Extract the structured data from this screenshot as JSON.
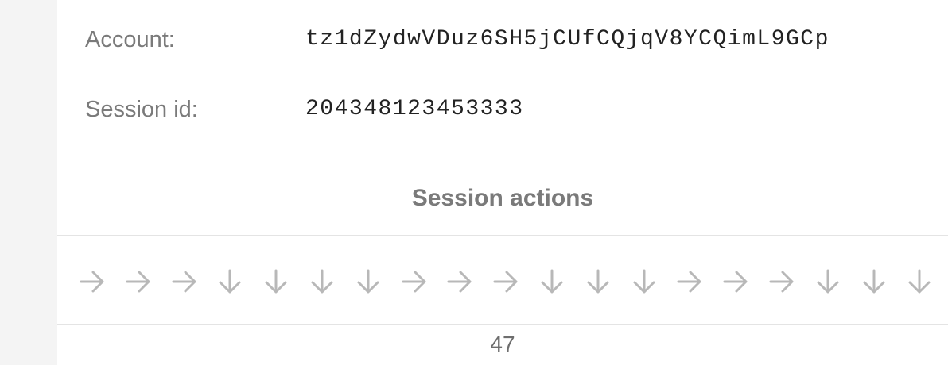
{
  "session_info": {
    "account_label": "Account:",
    "account_value": "tz1dZydwVDuz6SH5jCUfCQjqV8YCQimL9GCp",
    "session_label": "Session id:",
    "session_value": "204348123453333"
  },
  "actions": {
    "title": "Session actions",
    "icon_color": "#b8b8b8",
    "sequence": [
      "right",
      "right",
      "right",
      "down",
      "down",
      "down",
      "down",
      "right",
      "right",
      "right",
      "down",
      "down",
      "down",
      "right",
      "right",
      "right",
      "down",
      "down",
      "down"
    ]
  },
  "footer": {
    "page_number": "47"
  }
}
